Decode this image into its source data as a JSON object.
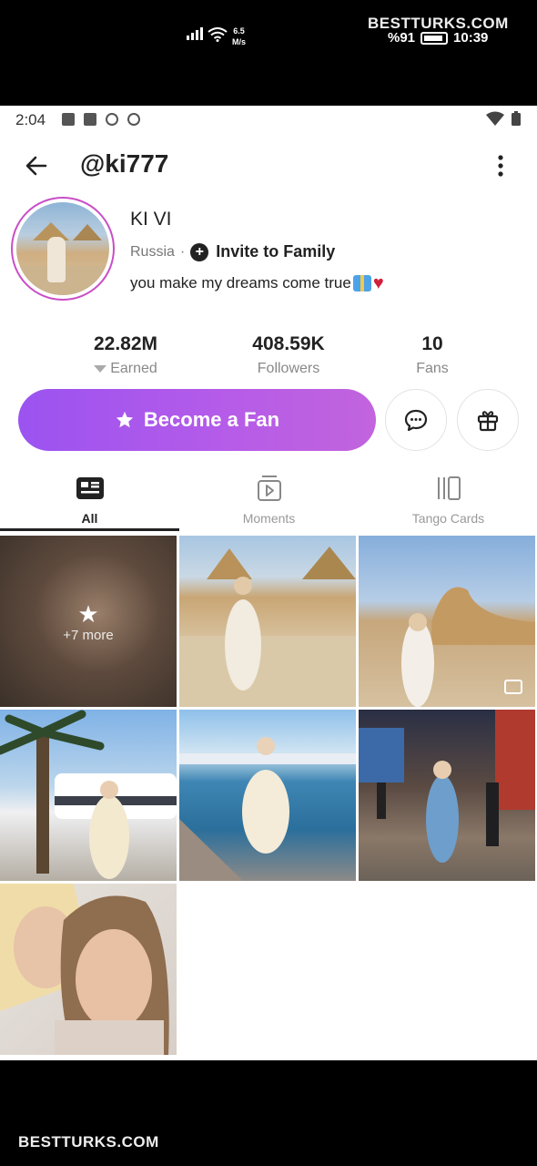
{
  "overlay": {
    "watermark_top": "BESTTURKS.COM",
    "network_speed": "6.5",
    "network_unit": "M/s",
    "battery_percent": "%91",
    "clock": "10:39",
    "watermark_bottom": "BESTTURKS.COM"
  },
  "status_bar": {
    "time": "2:04"
  },
  "header": {
    "handle": "@ki777"
  },
  "profile": {
    "name": "KI VI",
    "country": "Russia",
    "separator": "·",
    "invite_label": "Invite to Family",
    "bio": "you make my dreams come true"
  },
  "stats": [
    {
      "value": "22.82M",
      "label": "Earned"
    },
    {
      "value": "408.59K",
      "label": "Followers"
    },
    {
      "value": "10",
      "label": "Fans"
    }
  ],
  "actions": {
    "become_fan_label": "Become a Fan"
  },
  "tabs": [
    {
      "label": "All",
      "icon": "profile-card-icon",
      "active": true
    },
    {
      "label": "Moments",
      "icon": "play-stack-icon",
      "active": false
    },
    {
      "label": "Tango Cards",
      "icon": "cards-icon",
      "active": false
    }
  ],
  "grid": {
    "locked_more_label": "+7 more"
  },
  "colors": {
    "accent_start": "#9b53f0",
    "accent_end": "#c264dd",
    "avatar_ring": "#c94ec6"
  }
}
